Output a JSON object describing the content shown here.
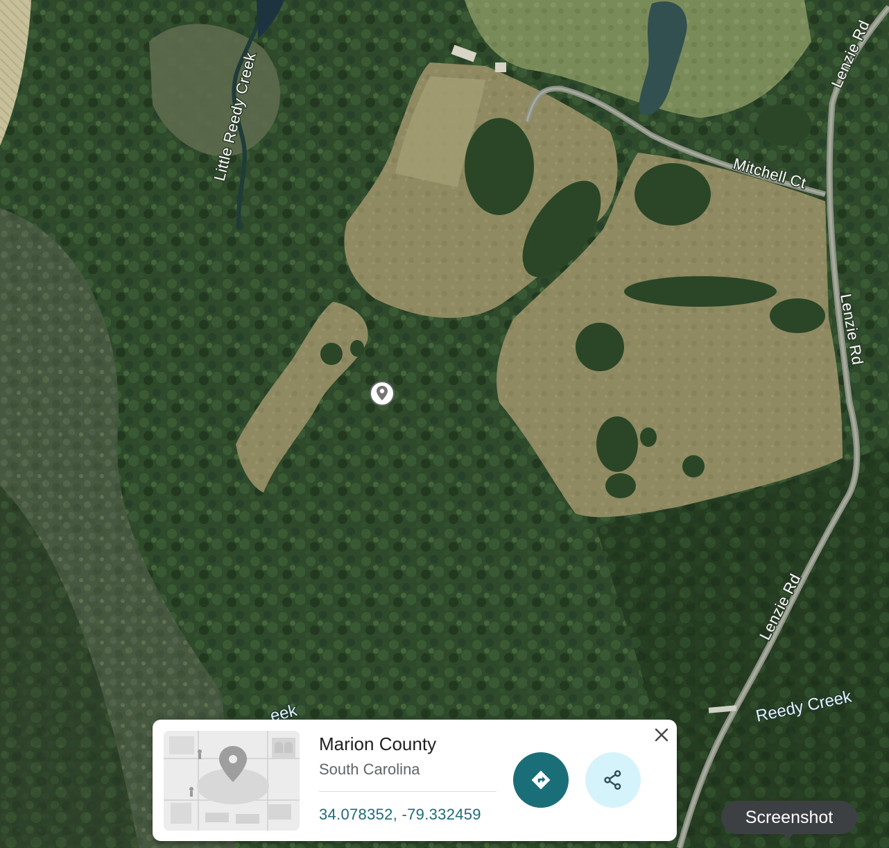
{
  "map": {
    "labels": {
      "little_reedy_creek": "Little Reedy Creek",
      "lenzie_rd_top": "Lenzie Rd",
      "mitchell_ct": "Mitchell Ct",
      "lenzie_rd_mid": "Lenzie Rd",
      "lenzie_rd_bottom": "Lenzie Rd",
      "reedy_creek": "Reedy Creek",
      "creek_partial": "eek"
    },
    "marker_icon": "location-pin-icon"
  },
  "info_card": {
    "title": "Marion County",
    "subtitle": "South Carolina",
    "coordinates": "34.078352, -79.332459",
    "thumbnail_icon": "map-placeholder-icon",
    "directions_icon": "directions-icon",
    "share_icon": "share-icon",
    "close_icon": "close-icon"
  },
  "tooltip": {
    "text": "Screenshot"
  },
  "colors": {
    "directions_button": "#1a6e78",
    "share_button": "#d5f3fb",
    "coordinates_text": "#1d6b78",
    "tooltip_bg": "#3c4043"
  }
}
